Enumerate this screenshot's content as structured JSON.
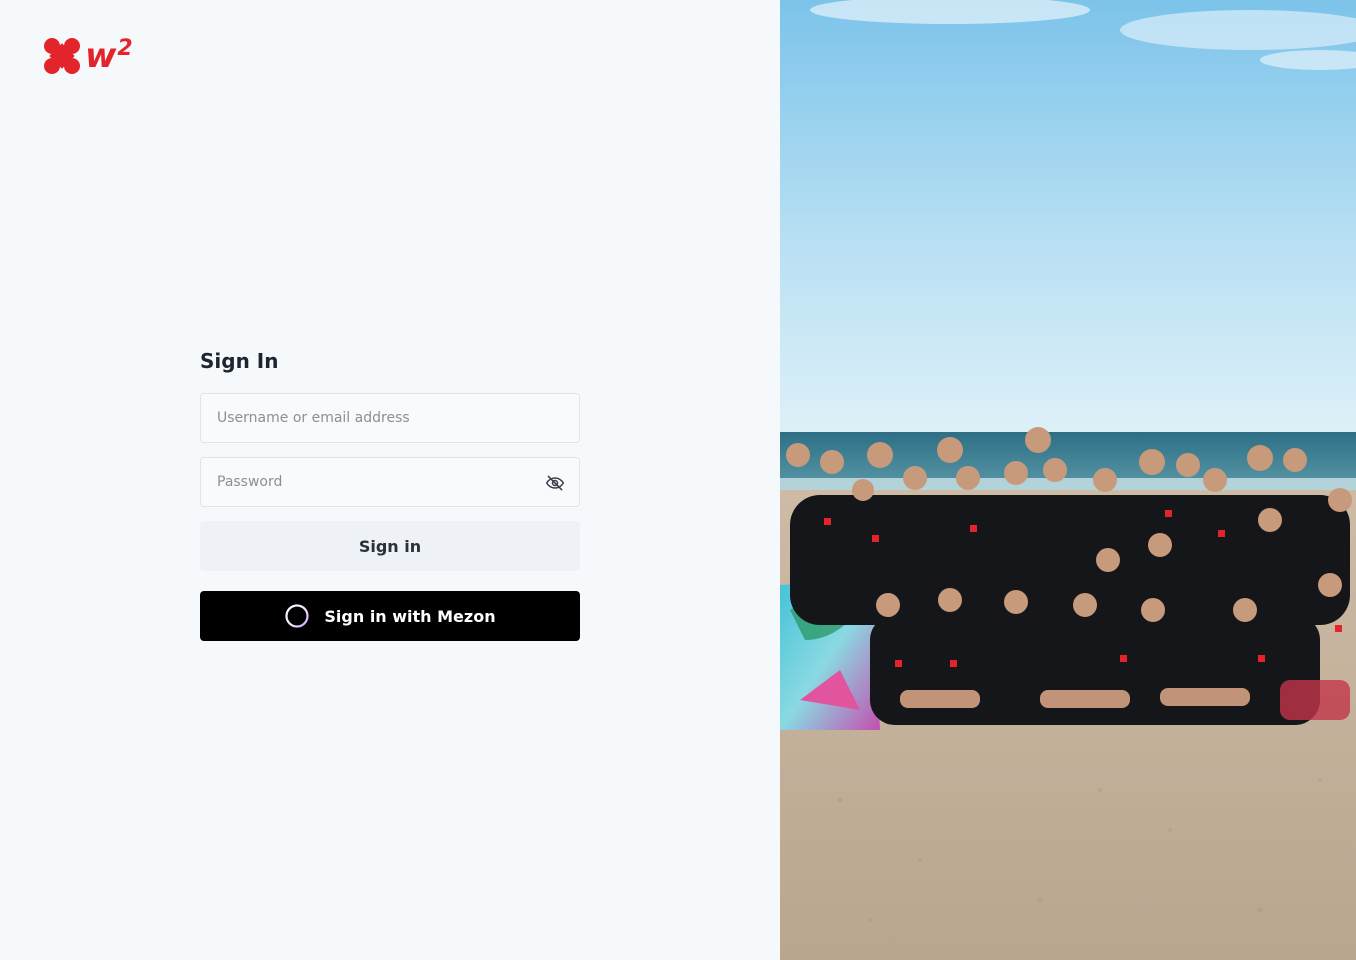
{
  "brand": {
    "name": "w",
    "superscript": "2",
    "color": "#e3252b",
    "icon": "flower-logo-icon"
  },
  "signin": {
    "title": "Sign In",
    "username_placeholder": "Username or email address",
    "password_placeholder": "Password",
    "password_toggle_icon": "eye-off-icon",
    "signin_button": "Sign in",
    "mezon_button": "Sign in with Mezon",
    "mezon_icon": "mezon-ring-icon"
  },
  "hero_image": {
    "subject": "team-group-photo-beach"
  }
}
